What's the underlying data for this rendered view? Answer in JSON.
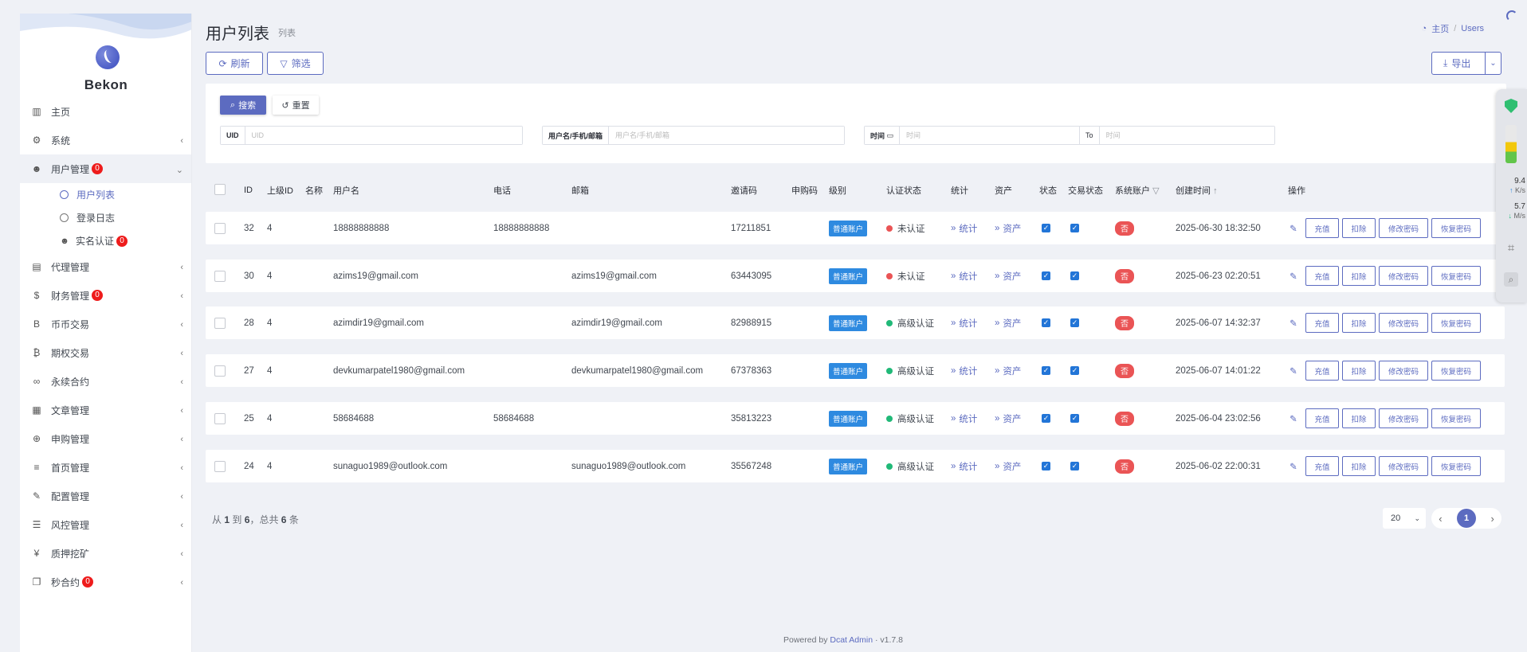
{
  "app": {
    "brand": "Bekon"
  },
  "sidebar": {
    "items": [
      {
        "label": "主页",
        "icon": "bar-chart-icon",
        "glyph": "▥",
        "arrow": "",
        "badge": null
      },
      {
        "label": "系统",
        "icon": "gear-icon",
        "glyph": "⚙",
        "arrow": "‹",
        "badge": null
      },
      {
        "label": "用户管理",
        "icon": "user-icon",
        "glyph": "☻",
        "arrow": "⌄",
        "badge": "0"
      },
      {
        "label": "代理管理",
        "icon": "id-card-icon",
        "glyph": "▤",
        "arrow": "‹",
        "badge": null
      },
      {
        "label": "财务管理",
        "icon": "dollar-icon",
        "glyph": "$",
        "arrow": "‹",
        "badge": "0"
      },
      {
        "label": "币币交易",
        "icon": "bitcoin-b-icon",
        "glyph": "B",
        "arrow": "‹",
        "badge": null
      },
      {
        "label": "期权交易",
        "icon": "bitcoin-icon",
        "glyph": "₿",
        "arrow": "‹",
        "badge": null
      },
      {
        "label": "永续合约",
        "icon": "link-icon",
        "glyph": "∞",
        "arrow": "‹",
        "badge": null
      },
      {
        "label": "文章管理",
        "icon": "newspaper-icon",
        "glyph": "▦",
        "arrow": "‹",
        "badge": null
      },
      {
        "label": "申购管理",
        "icon": "globe-icon",
        "glyph": "⊕",
        "arrow": "‹",
        "badge": null
      },
      {
        "label": "首页管理",
        "icon": "list-icon",
        "glyph": "≡",
        "arrow": "‹",
        "badge": null
      },
      {
        "label": "配置管理",
        "icon": "wrench-icon",
        "glyph": "✎",
        "arrow": "‹",
        "badge": null
      },
      {
        "label": "风控管理",
        "icon": "indent-list-icon",
        "glyph": "☰",
        "arrow": "‹",
        "badge": null
      },
      {
        "label": "质押挖矿",
        "icon": "yen-icon",
        "glyph": "¥",
        "arrow": "‹",
        "badge": null
      },
      {
        "label": "秒合约",
        "icon": "copy-icon",
        "glyph": "❐",
        "arrow": "‹",
        "badge": "0"
      }
    ],
    "submenu": [
      {
        "label": "用户列表",
        "badge": null
      },
      {
        "label": "登录日志",
        "badge": null
      },
      {
        "label": "实名认证",
        "badge": "0"
      }
    ]
  },
  "header": {
    "title": "用户列表",
    "subtitle": "列表",
    "breadcrumb_home": "主页",
    "breadcrumb_current": "Users"
  },
  "toolbar": {
    "refresh_label": "刷新",
    "filter_label": "筛选",
    "export_label": "导出"
  },
  "filter": {
    "search_label": "搜索",
    "reset_label": "重置",
    "uid_label": "UID",
    "uid_placeholder": "UID",
    "user_label": "用户名/手机/邮箱",
    "user_placeholder": "用户名/手机/邮箱",
    "time_label": "时间",
    "time_placeholder": "时间",
    "to_label": "To",
    "to_placeholder": "时间"
  },
  "table": {
    "headers": {
      "id": "ID",
      "parent_id": "上级ID",
      "name": "名称",
      "username": "用户名",
      "phone": "电话",
      "email": "邮箱",
      "invite": "邀请码",
      "subscribe": "申购码",
      "level": "级别",
      "verify": "认证状态",
      "stats": "统计",
      "assets": "资产",
      "status": "状态",
      "trade_status": "交易状态",
      "system_account": "系统账户",
      "created": "创建时间",
      "actions": "操作"
    },
    "rows": [
      {
        "id": "32",
        "parent_id": "4",
        "name": "",
        "username": "18888888888",
        "phone": "18888888888",
        "email": "",
        "invite": "17211851",
        "level": "普通账户",
        "verify": "未认证",
        "verify_color": "#ea5455",
        "stats": "统计",
        "assets": "资产",
        "system": "否",
        "created": "2025-06-30 18:32:50"
      },
      {
        "id": "30",
        "parent_id": "4",
        "name": "",
        "username": "azims19@gmail.com",
        "phone": "",
        "email": "azims19@gmail.com",
        "invite": "63443095",
        "level": "普通账户",
        "verify": "未认证",
        "verify_color": "#ea5455",
        "stats": "统计",
        "assets": "资产",
        "system": "否",
        "created": "2025-06-23 02:20:51"
      },
      {
        "id": "28",
        "parent_id": "4",
        "name": "",
        "username": "azimdir19@gmail.com",
        "phone": "",
        "email": "azimdir19@gmail.com",
        "invite": "82988915",
        "level": "普通账户",
        "verify": "高级认证",
        "verify_color": "#21b978",
        "stats": "统计",
        "assets": "资产",
        "system": "否",
        "created": "2025-06-07 14:32:37"
      },
      {
        "id": "27",
        "parent_id": "4",
        "name": "",
        "username": "devkumarpatel1980@gmail.com",
        "phone": "",
        "email": "devkumarpatel1980@gmail.com",
        "invite": "67378363",
        "level": "普通账户",
        "verify": "高级认证",
        "verify_color": "#21b978",
        "stats": "统计",
        "assets": "资产",
        "system": "否",
        "created": "2025-06-07 14:01:22"
      },
      {
        "id": "25",
        "parent_id": "4",
        "name": "",
        "username": "58684688",
        "phone": "58684688",
        "email": "",
        "invite": "35813223",
        "level": "普通账户",
        "verify": "高级认证",
        "verify_color": "#21b978",
        "stats": "统计",
        "assets": "资产",
        "system": "否",
        "created": "2025-06-04 23:02:56"
      },
      {
        "id": "24",
        "parent_id": "4",
        "name": "",
        "username": "sunaguo1989@outlook.com",
        "phone": "",
        "email": "sunaguo1989@outlook.com",
        "invite": "35567248",
        "level": "普通账户",
        "verify": "高级认证",
        "verify_color": "#21b978",
        "stats": "统计",
        "assets": "资产",
        "system": "否",
        "created": "2025-06-02 22:00:31"
      }
    ],
    "action_labels": [
      "充值",
      "扣除",
      "修改密码",
      "恢复密码"
    ]
  },
  "pagination": {
    "from": "1",
    "to": "6",
    "total": "6",
    "text_from": "从",
    "text_to": "到",
    "text_total": "，总共",
    "text_unit": "条",
    "per_page": "20",
    "current_page": "1"
  },
  "footer": {
    "powered_by": "Powered by",
    "brand": "Dcat Admin",
    "sep": "·",
    "version": "v1.7.8"
  },
  "float_panel": {
    "up_value": "9.4",
    "up_unit": "K/s",
    "down_value": "5.7",
    "down_unit": "M/s"
  },
  "colors": {
    "accent": "#5c6bc0",
    "tag_blue": "#2e8ae0",
    "danger": "#ea5455",
    "success": "#21b978"
  }
}
